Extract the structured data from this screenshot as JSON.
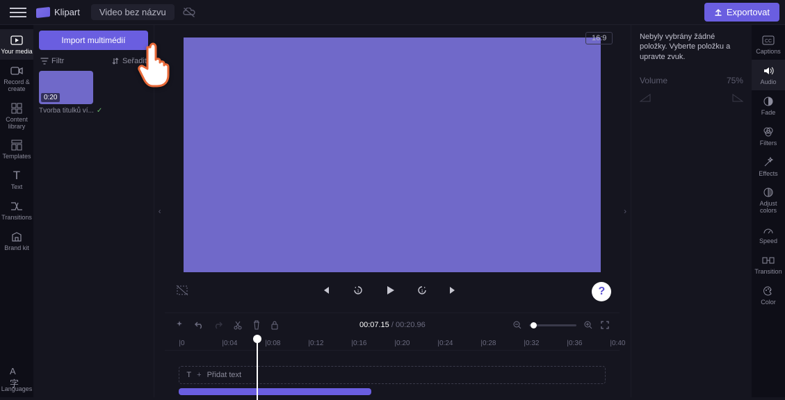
{
  "topbar": {
    "brand": "Klipart",
    "project_title": "Video bez názvu",
    "export_label": "Exportovat"
  },
  "left_rail": {
    "items": [
      {
        "label": "Your media"
      },
      {
        "label": "Record & create"
      },
      {
        "label": "Content library"
      },
      {
        "label": "Templates"
      },
      {
        "label": "Text"
      },
      {
        "label": "Transitions"
      },
      {
        "label": "Brand kit"
      }
    ],
    "bottom": {
      "label": "Languages"
    }
  },
  "media_panel": {
    "import_label": "Import multimédií",
    "filter_label": "Filtr",
    "sort_label": "Seřadit",
    "clip": {
      "duration": "0:20",
      "name": "Tvorba titulků ví..."
    }
  },
  "canvas": {
    "aspect": "16:9"
  },
  "player": {
    "current_time": "00:07.15",
    "total_time": "00:20.96"
  },
  "ruler": {
    "marks": [
      "0",
      "0:04",
      "0:08",
      "0:12",
      "0:16",
      "0:20",
      "0:24",
      "0:28",
      "0:32",
      "0:36",
      "0:40"
    ]
  },
  "tracks": {
    "add_text": "Přidat text"
  },
  "right_panel": {
    "message": "Nebyly vybrány žádné položky. Vyberte položku a upravte zvuk.",
    "volume_label": "Volume",
    "volume_value": "75%"
  },
  "right_rail": {
    "items": [
      {
        "label": "Captions"
      },
      {
        "label": "Audio"
      },
      {
        "label": "Fade"
      },
      {
        "label": "Filters"
      },
      {
        "label": "Effects"
      },
      {
        "label": "Adjust colors"
      },
      {
        "label": "Speed"
      },
      {
        "label": "Transition"
      },
      {
        "label": "Color"
      }
    ]
  }
}
